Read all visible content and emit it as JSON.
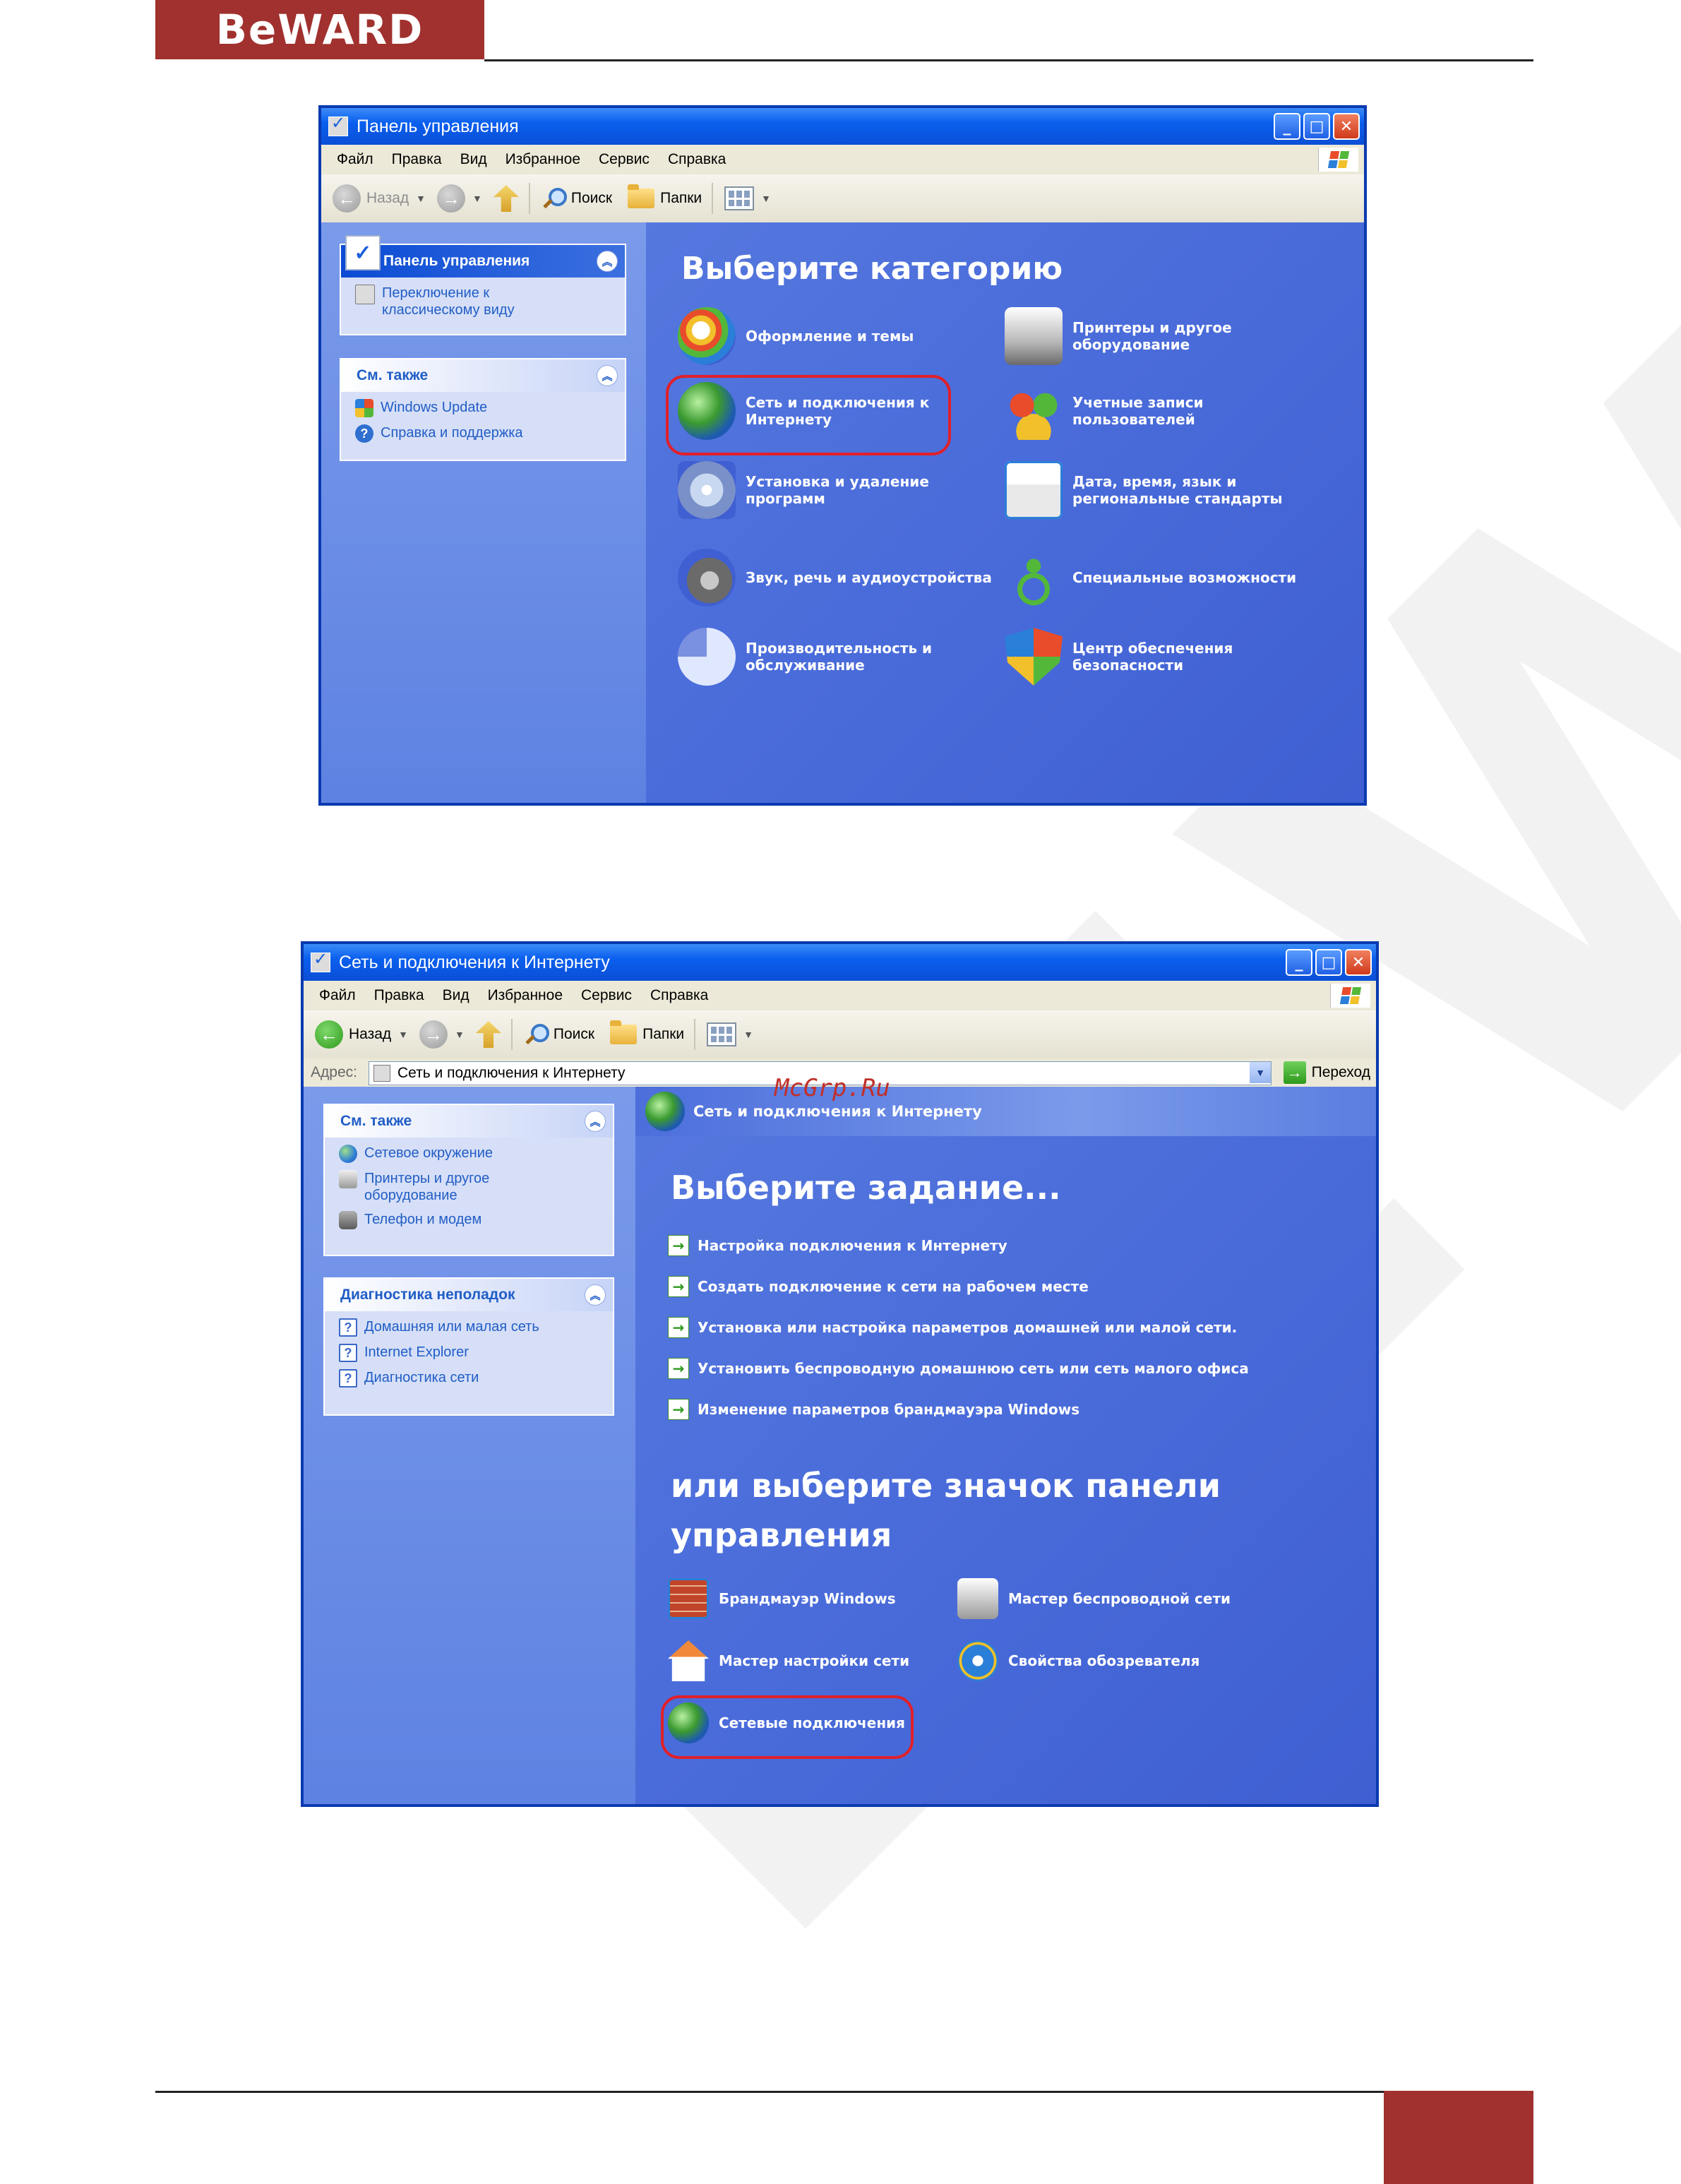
{
  "page": {
    "logo": "BeWARD",
    "watermark": "BEWARD",
    "site_mark": "McGrp.Ru"
  },
  "window1": {
    "title": "Панель управления",
    "menu": [
      "Файл",
      "Правка",
      "Вид",
      "Избранное",
      "Сервис",
      "Справка"
    ],
    "toolbar": {
      "back": "Назад",
      "search": "Поиск",
      "folders": "Папки"
    },
    "sidebar": {
      "panel1": {
        "title": "Панель управления",
        "items": [
          "Переключение к классическому виду"
        ]
      },
      "panel2": {
        "title": "См. также",
        "items": [
          "Windows Update",
          "Справка и поддержка"
        ]
      }
    },
    "main": {
      "heading": "Выберите категорию",
      "categories_left": [
        {
          "label": "Оформление и темы",
          "icon": "theme-icon"
        },
        {
          "label": "Сеть и подключения к Интернету",
          "icon": "network-icon"
        },
        {
          "label": "Установка и удаление программ",
          "icon": "install-icon"
        },
        {
          "label": "Звук, речь и аудиоустройства",
          "icon": "sound-icon"
        },
        {
          "label": "Производительность и обслуживание",
          "icon": "performance-icon"
        }
      ],
      "categories_right": [
        {
          "label": "Принтеры и другое оборудование",
          "icon": "printer-icon"
        },
        {
          "label": "Учетные записи пользователей",
          "icon": "users-icon"
        },
        {
          "label": "Дата, время, язык и региональные стандарты",
          "icon": "datetime-icon"
        },
        {
          "label": "Специальные возможности",
          "icon": "accessibility-icon"
        },
        {
          "label": "Центр обеспечения безопасности",
          "icon": "shield-icon"
        }
      ]
    }
  },
  "window2": {
    "title": "Сеть и подключения к Интернету",
    "menu": [
      "Файл",
      "Правка",
      "Вид",
      "Избранное",
      "Сервис",
      "Справка"
    ],
    "toolbar": {
      "back": "Назад",
      "search": "Поиск",
      "folders": "Папки"
    },
    "address": {
      "label": "Адрес:",
      "value": "Сеть и подключения к Интернету",
      "go": "Переход"
    },
    "sidebar": {
      "panel1": {
        "title": "См. также",
        "items": [
          "Сетевое окружение",
          "Принтеры и другое оборудование",
          "Телефон и модем"
        ]
      },
      "panel2": {
        "title": "Диагностика неполадок",
        "items": [
          "Домашняя или малая сеть",
          "Internet Explorer",
          "Диагностика сети"
        ]
      }
    },
    "main": {
      "crumb": "Сеть и подключения к Интернету",
      "heading1": "Выберите задание...",
      "tasks": [
        "Настройка подключения к Интернету",
        "Создать подключение к сети на рабочем месте",
        "Установка или настройка параметров домашней или малой сети.",
        "Установить беспроводную домашнюю сеть или сеть малого офиса",
        "Изменение параметров брандмауэра Windows"
      ],
      "heading2_line1": "или выберите значок панели",
      "heading2_line2": "управления",
      "icons": [
        {
          "label": "Брандмауэр Windows",
          "icon": "firewall-icon"
        },
        {
          "label": "Мастер беспроводной сети",
          "icon": "wireless-icon"
        },
        {
          "label": "Мастер настройки сети",
          "icon": "home-network-icon"
        },
        {
          "label": "Свойства обозревателя",
          "icon": "internet-options-icon"
        },
        {
          "label": "Сетевые подключения",
          "icon": "network-connections-icon"
        }
      ]
    }
  },
  "colors": {
    "brand": "#A0312E",
    "xp_blue": "#0B4BD4",
    "highlight_ring": "#E0202A"
  }
}
